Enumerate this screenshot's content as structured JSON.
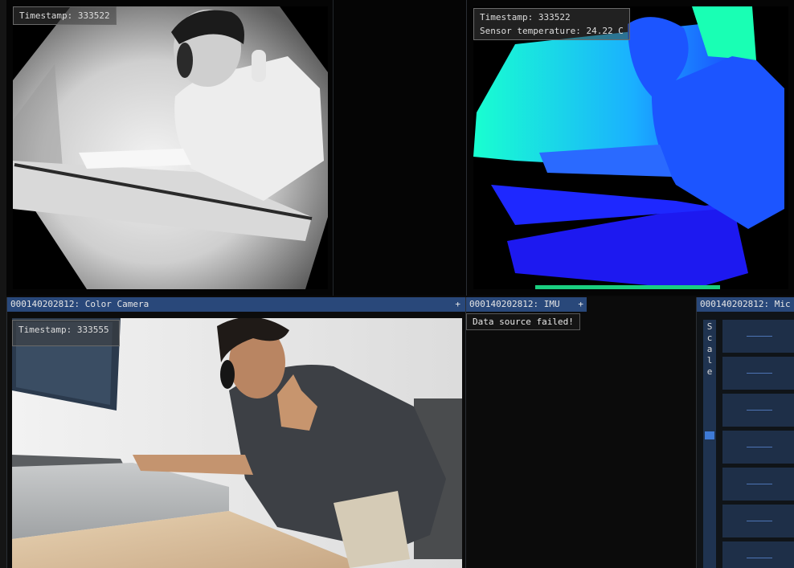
{
  "ir_view": {
    "timestamp": "Timestamp: 333522"
  },
  "depth_view": {
    "timestamp": "Timestamp: 333522",
    "sensor_temp": "Sensor temperature: 24.22 C"
  },
  "color_view": {
    "title": "000140202812: Color Camera",
    "plus": "+",
    "timestamp": "Timestamp: 333555"
  },
  "imu_view": {
    "title": "000140202812: IMU",
    "plus": "+",
    "error": "Data source failed!"
  },
  "mic_view": {
    "title": "000140202812: Mic",
    "scale_label": [
      "S",
      "c",
      "a",
      "l",
      "e"
    ]
  },
  "colors": {
    "title_bar": "#29487a",
    "depth_near": "#1a2cff",
    "depth_far": "#19ffd0",
    "mic_cell": "#1e2f48",
    "slider_handle": "#3e7ad6"
  }
}
